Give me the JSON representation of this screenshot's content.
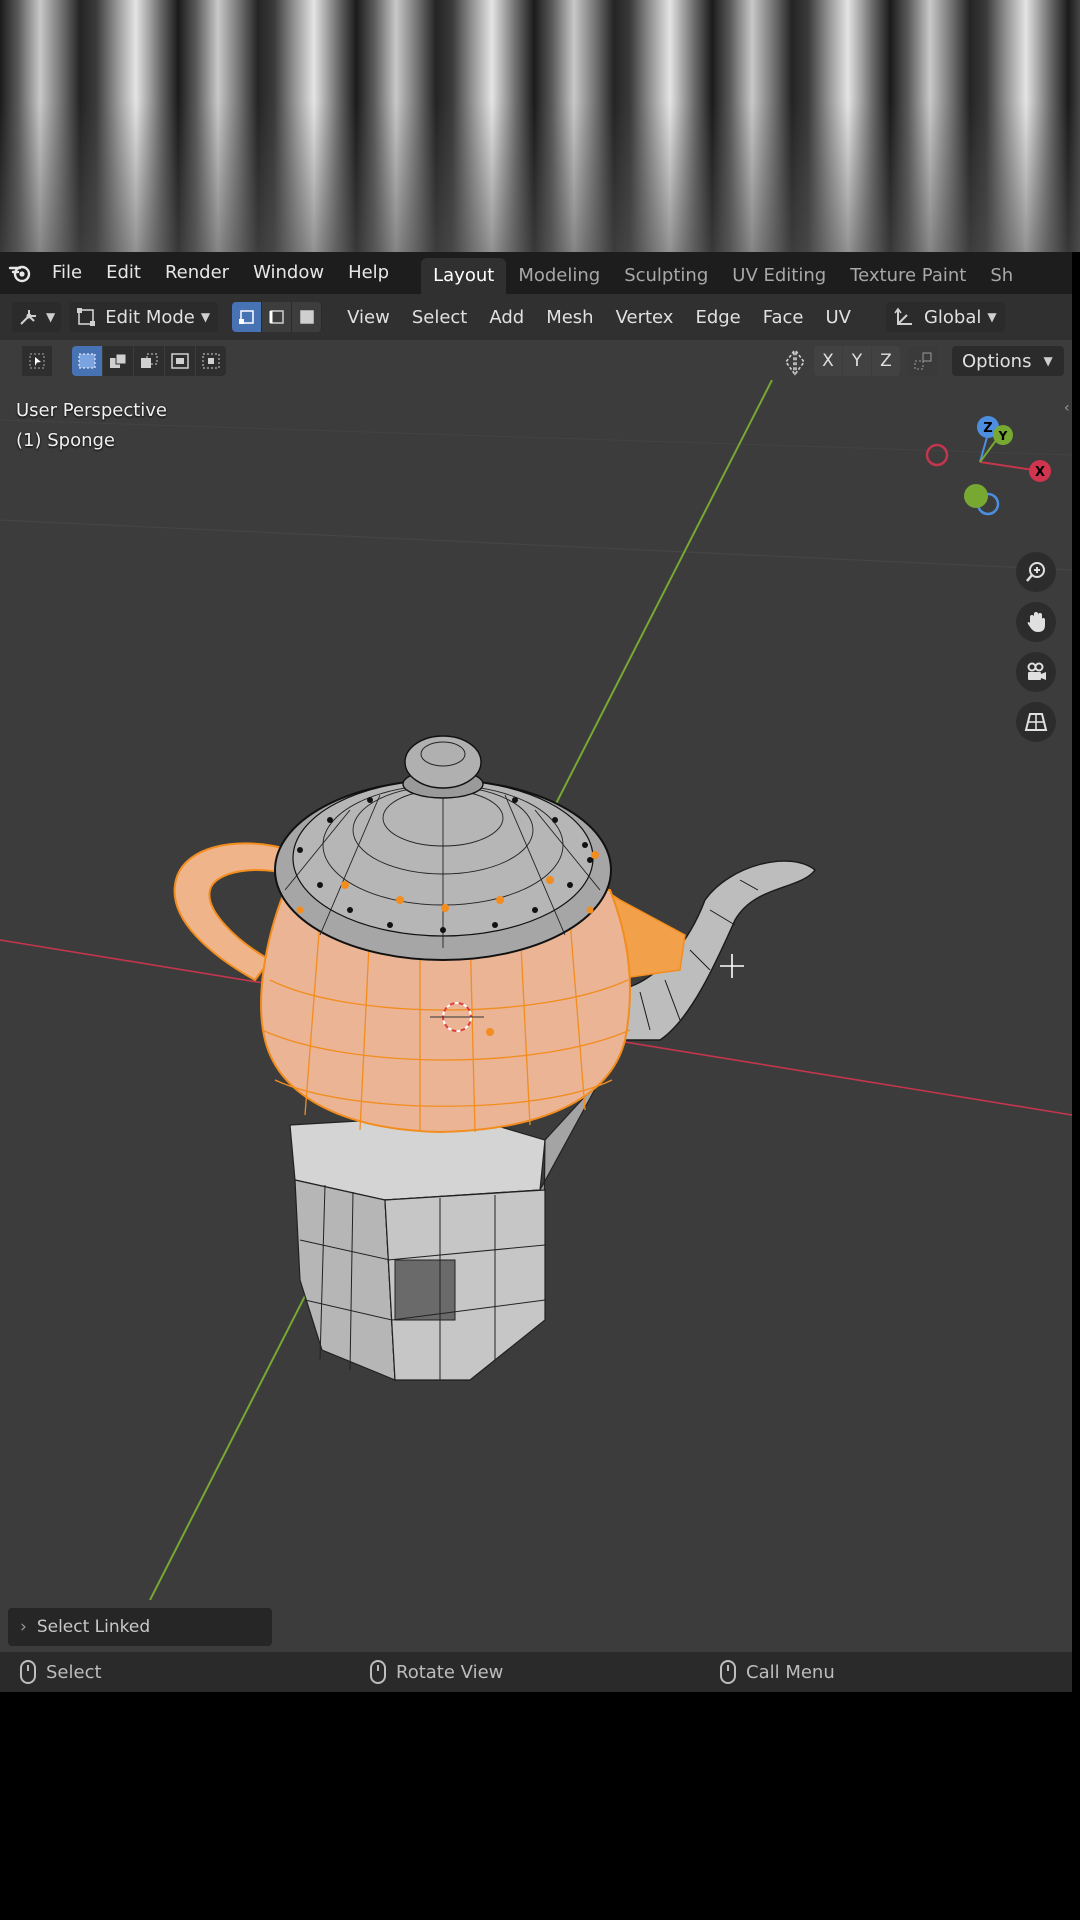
{
  "menubar": {
    "logo": "blender-icon",
    "menus": [
      "File",
      "Edit",
      "Render",
      "Window",
      "Help"
    ],
    "workspace_tabs": [
      "Layout",
      "Modeling",
      "Sculpting",
      "UV Editing",
      "Texture Paint",
      "Sh"
    ],
    "active_tab": "Layout"
  },
  "header": {
    "mode": "Edit Mode",
    "menus": [
      "View",
      "Select",
      "Add",
      "Mesh",
      "Vertex",
      "Edge",
      "Face",
      "UV"
    ],
    "transform_orientation": "Global"
  },
  "toolrow": {
    "axes": [
      "X",
      "Y",
      "Z"
    ],
    "options_label": "Options"
  },
  "viewport": {
    "view_name": "User Perspective",
    "object_name": "(1) Sponge",
    "gizmo": {
      "z": "Z",
      "y": "Y",
      "x": "X"
    },
    "colors": {
      "selected": "#f28d1e",
      "mesh": "#b4b4b4",
      "x_axis": "#c4364d",
      "y_axis": "#76a832",
      "background": "#3c3c3c"
    }
  },
  "last_operation": "Select Linked",
  "statusbar": {
    "left": "Select",
    "middle": "Rotate View",
    "right": "Call Menu"
  }
}
